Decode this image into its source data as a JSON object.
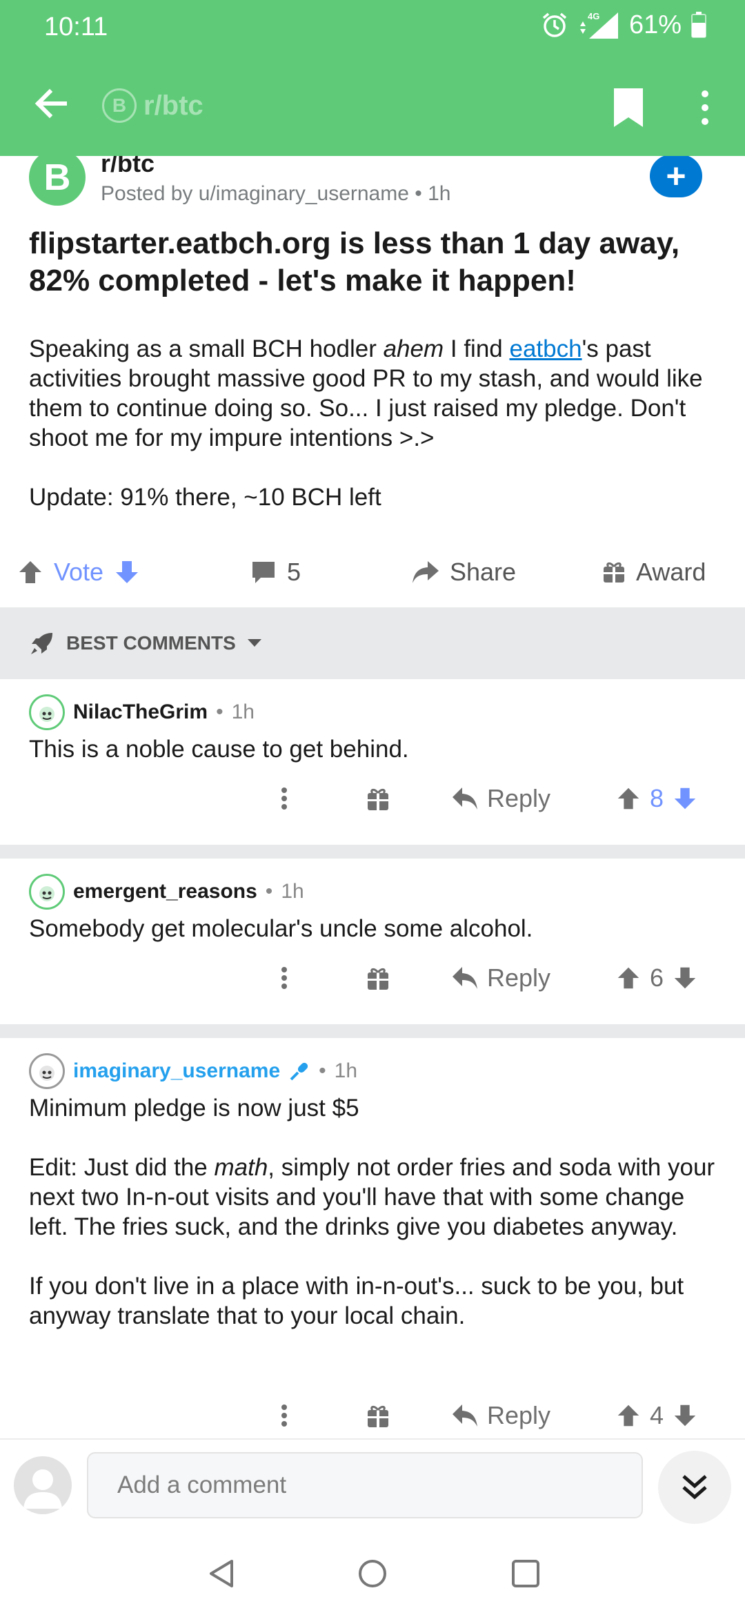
{
  "status_bar": {
    "time": "10:11",
    "network": "4G",
    "battery": "61%"
  },
  "app_bar": {
    "subreddit": "r/btc",
    "icons": [
      "back-arrow-icon",
      "bookmark-icon",
      "more-vertical-icon"
    ]
  },
  "post": {
    "avatar_letter": "B",
    "subreddit": "r/btc",
    "posted_by": "Posted by u/imaginary_username",
    "time": "1h",
    "title": "flipstarter.eatbch.org is less than 1 day away, 82% completed - let's make it happen!",
    "body": {
      "p1_before": "Speaking as a small BCH hodler ",
      "p1_italic": "ahem",
      "p1_mid": " I find ",
      "p1_link": "eatbch",
      "p1_after": "'s past activities brought massive good PR to my stash, and would like them to continue doing so. So... I just raised my pledge. Don't shoot me for my impure intentions >.>",
      "p2": "Update: 91% there, ~10 BCH left"
    },
    "actions": {
      "vote_label": "Vote",
      "comments_count": "5",
      "share_label": "Share",
      "award_label": "Award"
    }
  },
  "sort": {
    "label": "BEST COMMENTS"
  },
  "comments": [
    {
      "user": "NilacTheGrim",
      "time": "1h",
      "text": "This is a noble cause to get behind.",
      "reply_label": "Reply",
      "score": "8"
    },
    {
      "user": "emergent_reasons",
      "time": "1h",
      "text": "Somebody get molecular's uncle some alcohol.",
      "reply_label": "Reply",
      "score": "6"
    },
    {
      "user": "imaginary_username",
      "time": "1h",
      "p1": "Minimum pledge is now just $5",
      "p2_before": "Edit: Just did the ",
      "p2_italic": "math",
      "p2_after": ", simply not order fries and soda with your next two In-n-out visits and you'll have that with some change left. The fries suck, and the drinks give you diabetes anyway.",
      "p3": "If you don't live in a place with in-n-out's... suck to be you, but anyway translate that to your local chain.",
      "reply_label": "Reply",
      "score": "4"
    }
  ],
  "composer": {
    "placeholder": "Add a comment"
  },
  "colors": {
    "brand_green": "#5fcb78",
    "upvote_blue": "#7193ff",
    "link_blue": "#0079d3",
    "op_blue": "#24a0ed"
  }
}
